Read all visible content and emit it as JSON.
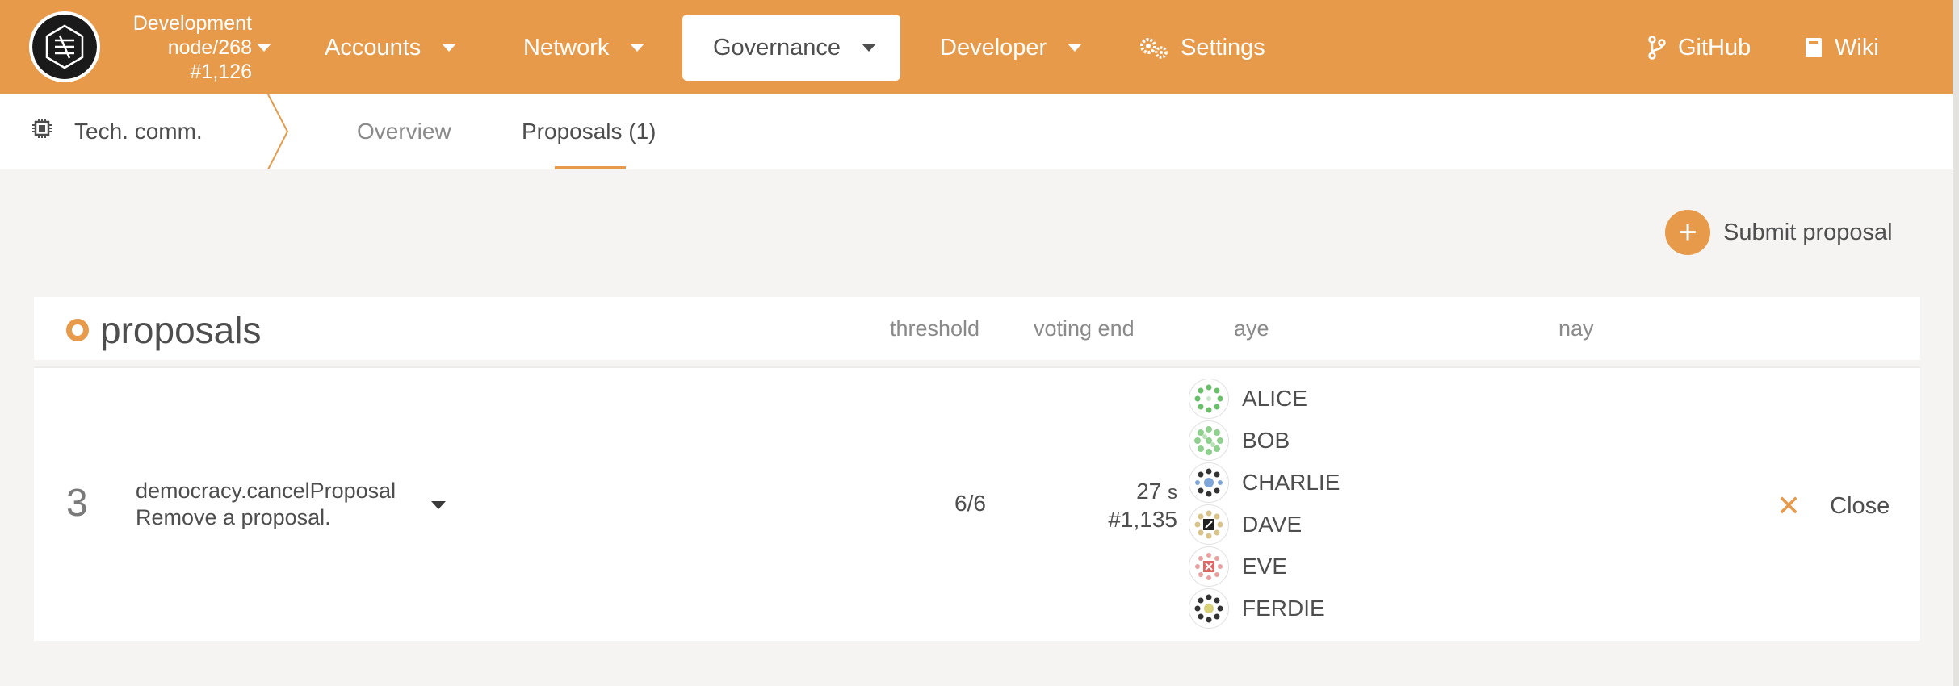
{
  "chain": {
    "line1": "Development",
    "line2": "node/268",
    "line3": "#1,126"
  },
  "nav": {
    "accounts": "Accounts",
    "network": "Network",
    "governance": "Governance",
    "developer": "Developer",
    "settings": "Settings",
    "github": "GitHub",
    "wiki": "Wiki"
  },
  "subnav": {
    "title": "Tech. comm.",
    "tabs": [
      "Overview",
      "Proposals (1)"
    ]
  },
  "submit_label": "Submit proposal",
  "table": {
    "title": "proposals",
    "headers": {
      "threshold": "threshold",
      "voting_end": "voting end",
      "aye": "aye",
      "nay": "nay"
    },
    "row": {
      "index": "3",
      "call": "democracy.cancelProposal",
      "description": "Remove a proposal.",
      "threshold": "6/6",
      "voting_time": "27",
      "voting_unit": "s",
      "voting_block": "#1,135",
      "ayes": [
        "ALICE",
        "BOB",
        "CHARLIE",
        "DAVE",
        "EVE",
        "FERDIE"
      ],
      "close_label": "Close"
    }
  },
  "colors": {
    "accent": "#e69a4a",
    "text": "#4e4e4e",
    "muted": "#8a8a8a",
    "background": "#f5f4f3"
  }
}
